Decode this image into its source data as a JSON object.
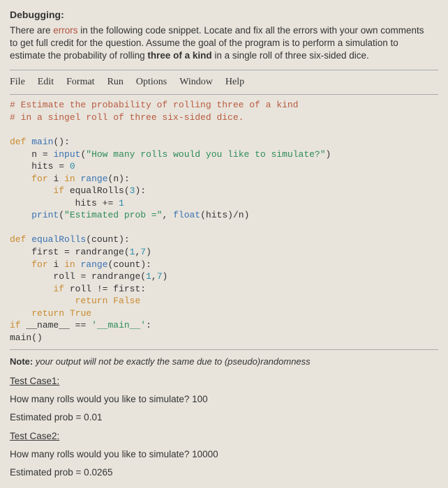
{
  "heading": "Debugging:",
  "instructions": {
    "l1a": "There are ",
    "l1b": "errors",
    "l1c": " in the following code snippet. Locate and fix all the errors with your own comments",
    "l2": "to get full credit for the question. Assume the goal of the program is to perform a simulation to",
    "l3a": "estimate the probability of rolling ",
    "l3b": "three of a kind",
    "l3c": " in a single roll of three six-sided dice."
  },
  "menu": {
    "file": "File",
    "edit": "Edit",
    "format": "Format",
    "run": "Run",
    "options": "Options",
    "window": "Window",
    "help": "Help"
  },
  "code": {
    "c1": "# Estimate the probability of rolling three of a kind",
    "c2": "# in a singel roll of three six-sided dice.",
    "blank": "",
    "kw_def": "def",
    "kw_for": "for",
    "kw_in": "in",
    "kw_if": "if",
    "kw_return": "return",
    "fn_main": "main",
    "fn_input": "input",
    "fn_range": "range",
    "fn_print": "print",
    "fn_randrange": "randrange",
    "fn_equalRolls": "equalRolls",
    "fn_float": "float",
    "s1": "\"How many rolls would you like to simulate?\"",
    "s2": "\"Estimated prob =\"",
    "s3": "'__main__'",
    "n0": "0",
    "n1": "1",
    "n3": "3",
    "n7": "7",
    "id_n": "n",
    "id_hits": "hits",
    "id_i": "i",
    "id_count": "count",
    "id_first": "first",
    "id_roll": "roll",
    "id_name": "__name__",
    "op_colon": ":",
    "op_eq": " = ",
    "op_pluseq": " += ",
    "op_comma": ", ",
    "op_comma2": ",",
    "op_lpar": "(",
    "op_rpar": ")",
    "op_slash": "/",
    "op_ne": " != ",
    "op_deq": " == ",
    "lit_True": "True",
    "lit_False": "False"
  },
  "note": {
    "label": "Note:",
    "text": " your output will not be exactly the same due to (pseudo)randomness"
  },
  "tc1": {
    "label": "Test Case1:",
    "q": "How many rolls would you like to simulate? 100",
    "r": "Estimated prob = 0.01"
  },
  "tc2": {
    "label": "Test Case2:",
    "q": "How many rolls would you like to simulate? 10000",
    "r": "Estimated prob = 0.0265"
  }
}
